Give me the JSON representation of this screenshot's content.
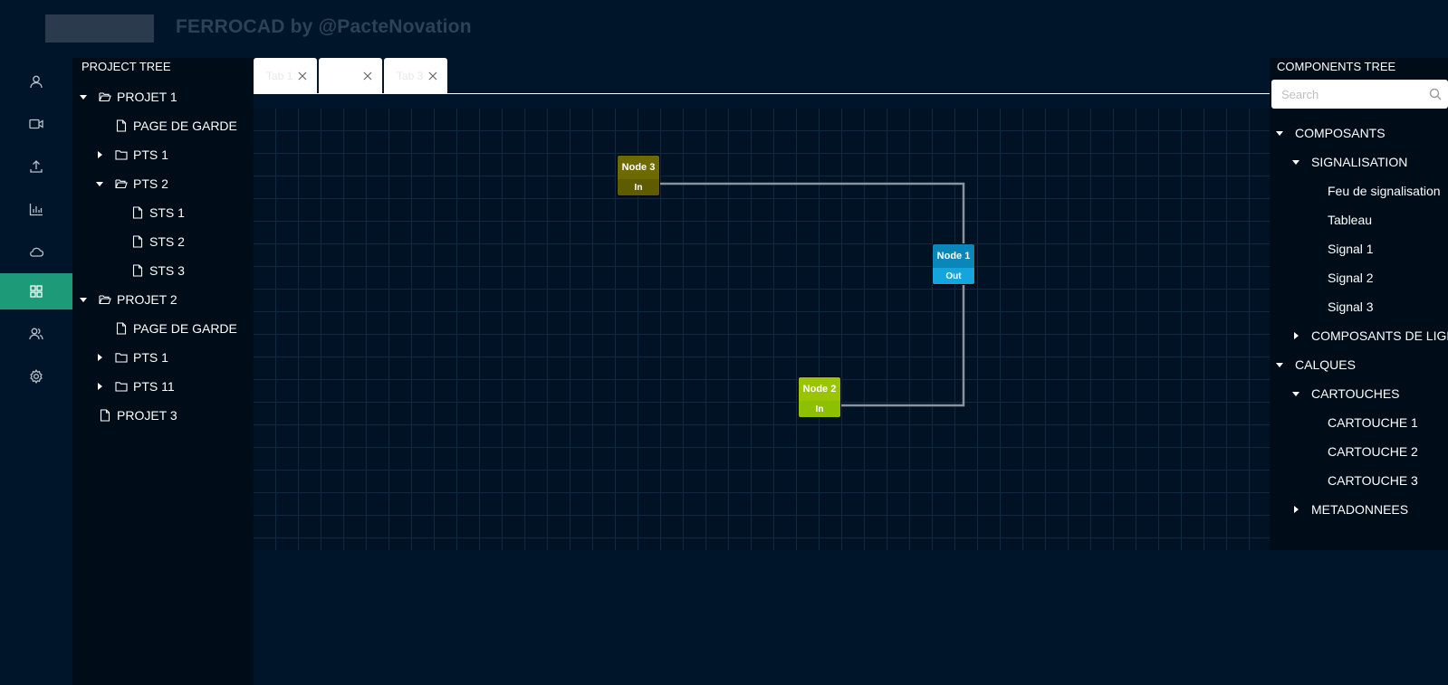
{
  "header": {
    "app_title": "FERROCAD by @PacteNovation"
  },
  "sidebar": {
    "items": [
      {
        "icon": "user-icon",
        "active": false
      },
      {
        "icon": "video-camera-icon",
        "active": false
      },
      {
        "icon": "upload-icon",
        "active": false
      },
      {
        "icon": "bar-chart-icon",
        "active": false
      },
      {
        "icon": "cloud-icon",
        "active": false
      },
      {
        "icon": "appstore-icon",
        "active": true
      },
      {
        "icon": "team-icon",
        "active": false
      },
      {
        "icon": "setting-icon",
        "active": false
      }
    ],
    "active_color": "#1d9b78"
  },
  "project_tree": {
    "title": "PROJECT TREE",
    "items": [
      {
        "label": "PROJET 1",
        "level": 0,
        "type": "folder",
        "expanded": true
      },
      {
        "label": "PAGE DE GARDE",
        "level": 1,
        "type": "file"
      },
      {
        "label": "PTS 1",
        "level": 1,
        "type": "folder",
        "expanded": false
      },
      {
        "label": "PTS 2",
        "level": 1,
        "type": "folder",
        "expanded": true
      },
      {
        "label": "STS 1",
        "level": 2,
        "type": "file"
      },
      {
        "label": "STS 2",
        "level": 2,
        "type": "file"
      },
      {
        "label": "STS 3",
        "level": 2,
        "type": "file"
      },
      {
        "label": "PROJET 2",
        "level": 0,
        "type": "folder",
        "expanded": true
      },
      {
        "label": "PAGE DE GARDE",
        "level": 1,
        "type": "file"
      },
      {
        "label": "PTS 1",
        "level": 1,
        "type": "folder",
        "expanded": false
      },
      {
        "label": "PTS 11",
        "level": 1,
        "type": "folder",
        "expanded": false
      },
      {
        "label": "PROJET 3",
        "level": 0,
        "type": "file"
      }
    ]
  },
  "tabs": [
    {
      "label": "Tab 1"
    },
    {
      "label": ""
    },
    {
      "label": "Tab 3"
    }
  ],
  "diagram": {
    "nodes": [
      {
        "title": "Node 3",
        "port": "In",
        "title_color": "#6e6a00",
        "port_color": "#5f5c00"
      },
      {
        "title": "Node 1",
        "port": "Out",
        "title_color": "#0a86b8",
        "port_color": "#16a4dc"
      },
      {
        "title": "Node 2",
        "port": "In",
        "title_color": "#9bc400",
        "port_color": "#8dc100"
      }
    ],
    "links": [
      {
        "from": "Node 3",
        "to": "Node 1"
      },
      {
        "from": "Node 2",
        "to": "Node 1"
      }
    ],
    "link_color": "#8a939b"
  },
  "components_tree": {
    "title": "COMPONENTS TREE",
    "search_placeholder": "Search",
    "items": [
      {
        "label": "COMPOSANTS",
        "level": 0,
        "expanded": true
      },
      {
        "label": "SIGNALISATION",
        "level": 1,
        "expanded": true
      },
      {
        "label": "Feu de signalisation",
        "level": 2
      },
      {
        "label": "Tableau",
        "level": 2
      },
      {
        "label": "Signal 1",
        "level": 2
      },
      {
        "label": "Signal 2",
        "level": 2
      },
      {
        "label": "Signal 3",
        "level": 2
      },
      {
        "label": "COMPOSANTS DE LIGNE",
        "level": 1,
        "expanded": false
      },
      {
        "label": "CALQUES",
        "level": 0,
        "expanded": true
      },
      {
        "label": "CARTOUCHES",
        "level": 1,
        "expanded": true
      },
      {
        "label": "CARTOUCHE 1",
        "level": 2
      },
      {
        "label": "CARTOUCHE 2",
        "level": 2
      },
      {
        "label": "CARTOUCHE 3",
        "level": 2
      },
      {
        "label": "METADONNEES",
        "level": 1,
        "expanded": false
      }
    ]
  }
}
